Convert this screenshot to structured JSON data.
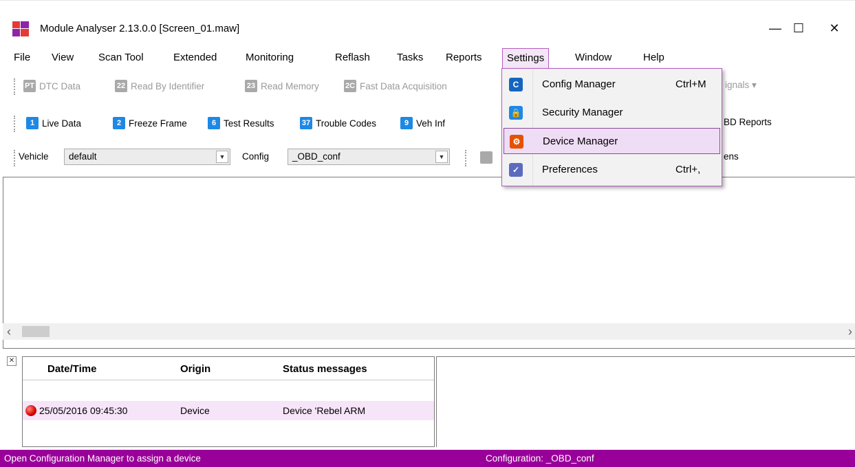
{
  "window": {
    "title": "Module Analyser 2.13.0.0 [Screen_01.maw]",
    "min_glyph": "—",
    "max_glyph": "☐",
    "close_glyph": "✕",
    "app_icon": "module-analyser-logo"
  },
  "menubar": {
    "items": [
      "File",
      "View",
      "Scan Tool",
      "Extended",
      "Monitoring",
      "Reflash",
      "Tasks",
      "Reports",
      "Settings",
      "Window",
      "Help"
    ],
    "active": "Settings"
  },
  "toolbar1": {
    "items": [
      {
        "label": "DTC Data",
        "icon": "dtc-icon",
        "glyph": "PT"
      },
      {
        "label": "Read By Identifier",
        "icon": "read-by-id-icon",
        "glyph": "22"
      },
      {
        "label": "Read Memory",
        "icon": "read-memory-icon",
        "glyph": "23"
      },
      {
        "label": "Fast Data Acquisition",
        "icon": "fast-data-icon",
        "glyph": "2C"
      }
    ],
    "overflow_label": "ignals ▾"
  },
  "toolbar2": {
    "items": [
      {
        "label": "Live Data",
        "icon": "live-data-icon",
        "glyph": "1"
      },
      {
        "label": "Freeze Frame",
        "icon": "freeze-frame-icon",
        "glyph": "2"
      },
      {
        "label": "Test Results",
        "icon": "test-results-icon",
        "glyph": "6"
      },
      {
        "label": "Trouble Codes",
        "icon": "trouble-codes-icon",
        "glyph": "37"
      },
      {
        "label": "Veh Inf",
        "icon": "veh-info-icon",
        "glyph": "9"
      }
    ],
    "overflow_label": "BD Reports"
  },
  "toolbar3": {
    "vehicle_label": "Vehicle",
    "vehicle_value": "default",
    "config_label": "Config",
    "config_value": "_OBD_conf",
    "overflow_label": "ens",
    "arrow": "▼"
  },
  "settings_menu": {
    "items": [
      {
        "label": "Config Manager",
        "shortcut": "Ctrl+M",
        "icon": "config-manager-icon",
        "glyph": "C",
        "color": "#1565c0"
      },
      {
        "label": "Security Manager",
        "shortcut": "",
        "icon": "security-manager-icon",
        "glyph": "🔒",
        "color": "#1e88e5"
      },
      {
        "label": "Device Manager",
        "shortcut": "",
        "icon": "device-manager-icon",
        "glyph": "⚙",
        "color": "#e65100"
      },
      {
        "label": "Preferences",
        "shortcut": "Ctrl+,",
        "icon": "preferences-icon",
        "glyph": "✓",
        "color": "#5c6bc0"
      }
    ],
    "highlighted": "Device Manager"
  },
  "scrollbar": {
    "left": "‹",
    "right": "›"
  },
  "status_panel": {
    "close_glyph": "✕",
    "columns": [
      "Date/Time",
      "Origin",
      "Status messages"
    ],
    "rows": [
      {
        "datetime": "25/05/2016 09:45:30",
        "origin": "Device",
        "message": "Device 'Rebel ARM",
        "level": "error"
      }
    ]
  },
  "statusbar": {
    "left": "Open Configuration Manager to assign a device",
    "config": "Configuration:  _OBD_conf"
  },
  "colors": {
    "accent": "#990099",
    "highlight": "#efdcf5",
    "toolbar_blue": "#1e88e5"
  }
}
